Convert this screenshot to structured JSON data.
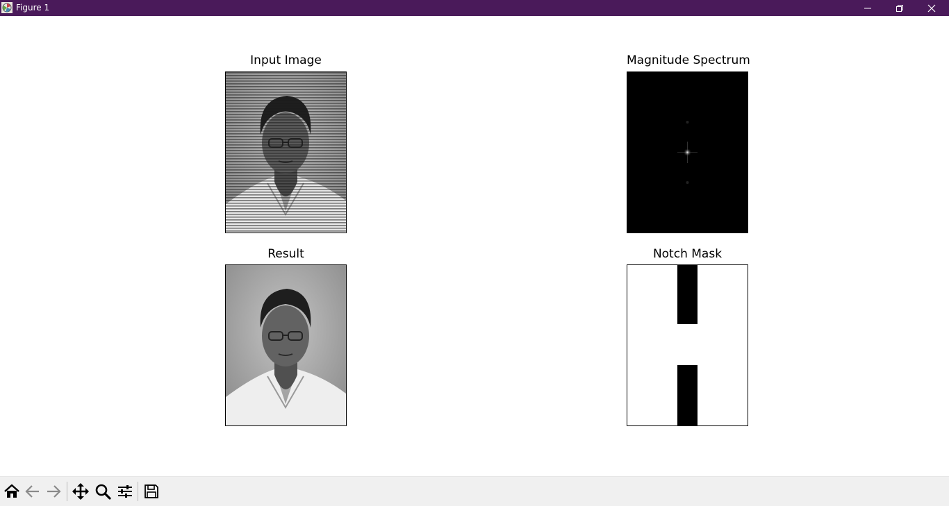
{
  "window": {
    "title": "Figure 1",
    "titlebar_color": "#4a1a5a",
    "controls": [
      "minimize-icon",
      "restore-icon",
      "close-icon"
    ]
  },
  "figure": {
    "background": "#ffffff",
    "subplots": [
      {
        "title": "Input Image",
        "content": "grayscale portrait with horizontal periodic stripe noise"
      },
      {
        "title": "Magnitude Spectrum",
        "content": "black field with bright center point and faint vertical peaks"
      },
      {
        "title": "Result",
        "content": "grayscale portrait after notch filtering"
      },
      {
        "title": "Notch Mask",
        "content": "white field with black vertical notch bands top and bottom"
      }
    ]
  },
  "toolbar": {
    "buttons": [
      {
        "name": "home-button",
        "icon": "home-icon"
      },
      {
        "name": "back-button",
        "icon": "back-arrow-icon"
      },
      {
        "name": "forward-button",
        "icon": "forward-arrow-icon"
      },
      {
        "name": "pan-button",
        "icon": "move-icon"
      },
      {
        "name": "zoom-button",
        "icon": "magnifier-icon"
      },
      {
        "name": "configure-subplots-button",
        "icon": "sliders-icon"
      },
      {
        "name": "save-button",
        "icon": "floppy-disk-icon"
      }
    ]
  }
}
